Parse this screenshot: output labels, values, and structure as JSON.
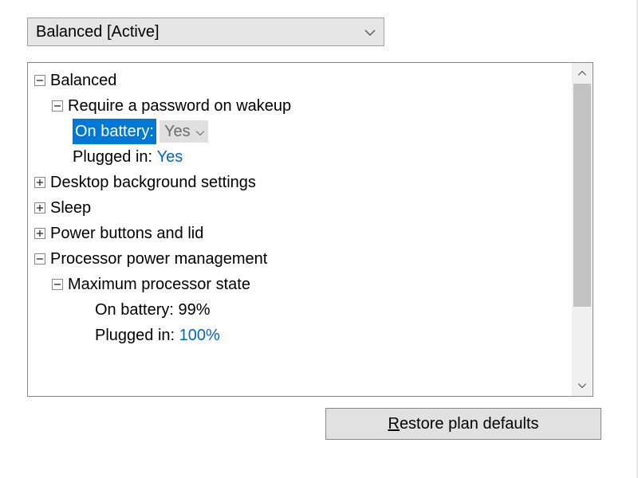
{
  "plan_selector": {
    "selected": "Balanced [Active]"
  },
  "tree": {
    "balanced": {
      "label": "Balanced"
    },
    "require_password": {
      "label": "Require a password on wakeup",
      "on_battery_label": "On battery:",
      "on_battery_value": "Yes",
      "plugged_in_label": "Plugged in:",
      "plugged_in_value": "Yes"
    },
    "desktop_bg": {
      "label": "Desktop background settings"
    },
    "sleep": {
      "label": "Sleep"
    },
    "power_buttons": {
      "label": "Power buttons and lid"
    },
    "processor_pm": {
      "label": "Processor power management"
    },
    "max_proc_state": {
      "label": "Maximum processor state",
      "on_battery_label": "On battery:",
      "on_battery_value": "99%",
      "plugged_in_label": "Plugged in:",
      "plugged_in_value": "100%"
    }
  },
  "buttons": {
    "restore_prefix": "R",
    "restore_rest": "estore plan defaults"
  }
}
